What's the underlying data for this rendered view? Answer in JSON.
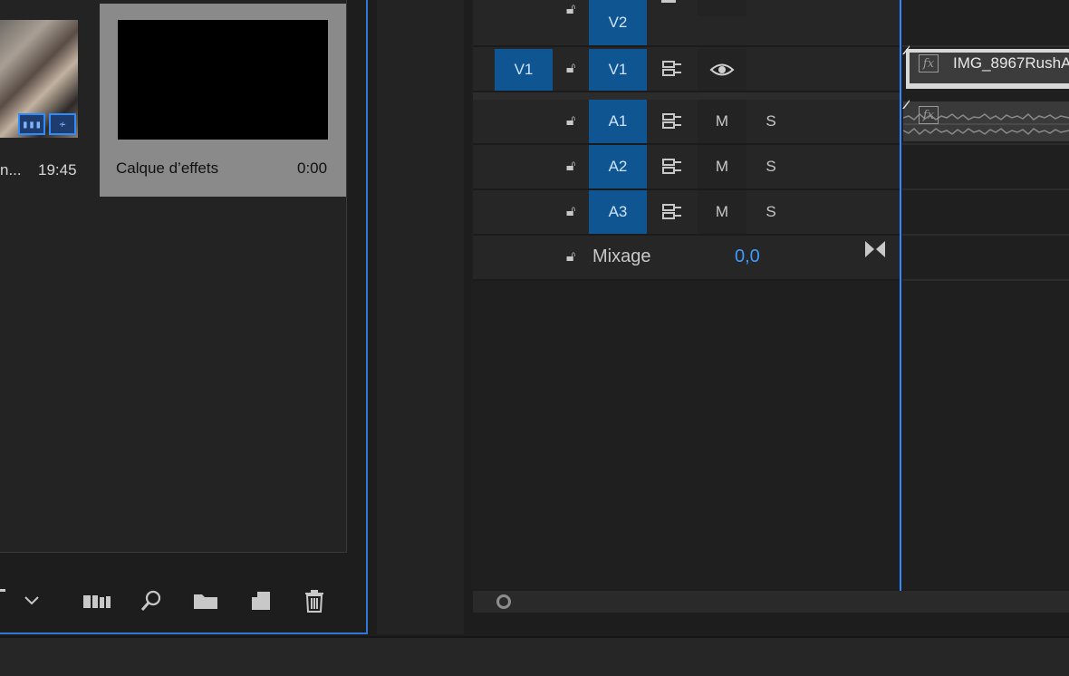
{
  "project_panel": {
    "clip": {
      "name": "n...",
      "duration": "19:45"
    },
    "effects_layer": {
      "name": "Calque d’effets",
      "duration": "0:00"
    },
    "toolbar_icons": [
      "chevron-down-icon",
      "freeform-view-icon",
      "search-icon",
      "new-bin-folder-icon",
      "new-item-icon",
      "trash-icon"
    ]
  },
  "timeline": {
    "video_tracks": [
      {
        "source": "",
        "target": "V2"
      },
      {
        "source": "V1",
        "target": "V1"
      }
    ],
    "audio_tracks": [
      {
        "target": "A1",
        "mute": "M",
        "solo": "S"
      },
      {
        "target": "A2",
        "mute": "M",
        "solo": "S"
      },
      {
        "target": "A3",
        "mute": "M",
        "solo": "S"
      }
    ],
    "mix": {
      "label": "Mixage",
      "value": "0,0"
    },
    "video_clip": {
      "name": "IMG_8967RushA",
      "fx": "fx"
    },
    "audio_clip": {
      "fx": "fx"
    }
  },
  "colors": {
    "accent": "#2f8cff",
    "track_target": "#0e5592"
  }
}
